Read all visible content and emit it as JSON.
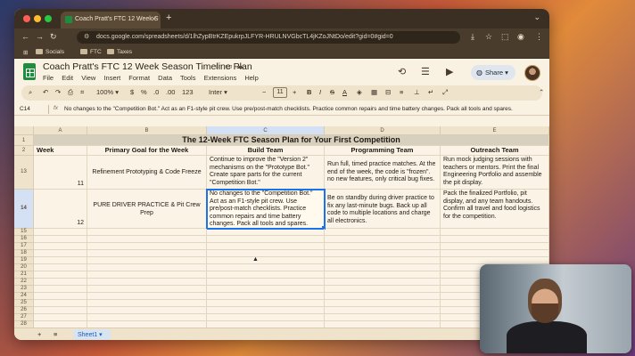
{
  "browser": {
    "tab_title": "Coach Pratt's FTC 12 Week S",
    "url": "docs.google.com/spreadsheets/d/1lhZypBtrKZEpukrpJLFYR-HRULNVGbcTL4jKZoJNtDo/edit?gid=0#gid=0",
    "bookmarks": [
      "Socials",
      "FTC",
      "Taxes"
    ]
  },
  "sheets": {
    "title": "Coach Pratt's FTC 12 Week Season Timeline Plan",
    "menus": [
      "File",
      "Edit",
      "View",
      "Insert",
      "Format",
      "Data",
      "Tools",
      "Extensions",
      "Help"
    ],
    "share_label": "Share"
  },
  "toolbar": {
    "zoom": "100%",
    "currency": "$",
    "percent": "%",
    "dec_less": ".0",
    "dec_more": ".00",
    "num_format": "123",
    "font": "Inter",
    "font_size": "11"
  },
  "formula_bar": {
    "cell_ref": "C14",
    "fx": "fx",
    "text": "No changes to the \"Competition Bot.\" Act as an F1-style pit crew. Use pre/post-match checklists. Practice common repairs and time battery changes. Pack all tools and spares."
  },
  "grid": {
    "columns": [
      "A",
      "B",
      "C",
      "D",
      "E"
    ],
    "banner": "The 12-Week FTC Season Plan for Your First Competition",
    "headers": [
      "Week",
      "Primary Goal for the Week",
      "Build Team",
      "Programming Team",
      "Outreach Team"
    ],
    "row_numbers": [
      "1",
      "2",
      "13",
      "14",
      "15",
      "16",
      "17",
      "18",
      "19",
      "20",
      "21",
      "22",
      "23",
      "24",
      "25",
      "26",
      "27",
      "28"
    ],
    "rows": [
      {
        "week": "11",
        "goal": "Refinement Prototyping & Code Freeze",
        "build": "Continue to improve the \"Version 2\" mechanisms on the \"Prototype Bot.\" Create spare parts for the current \"Competition Bot.\"",
        "programming": "Run full, timed practice matches. At the end of the week, the code is \"frozen\". no new features, only critical bug fixes.",
        "outreach": "Run mock judging sessions with teachers or mentors. Print the final Engineering Portfolio and assemble the pit display."
      },
      {
        "week": "12",
        "goal": "PURE DRIVER PRACTICE & Pit Crew Prep",
        "build": "No changes to the \"Competition Bot.\" Act as an F1-style pit crew. Use pre/post-match checklists. Practice common repairs and time battery changes. Pack all tools and spares.",
        "programming": "Be on standby during driver practice to fix any last-minute bugs. Back up all code to multiple locations and charge all electronics.",
        "outreach": "Pack the finalized Portfolio, pit display, and any team handouts. Confirm all travel and food logistics for the competition."
      }
    ]
  },
  "sheet_tabs": {
    "add": "+",
    "all": "≡",
    "active": "Sheet1"
  }
}
